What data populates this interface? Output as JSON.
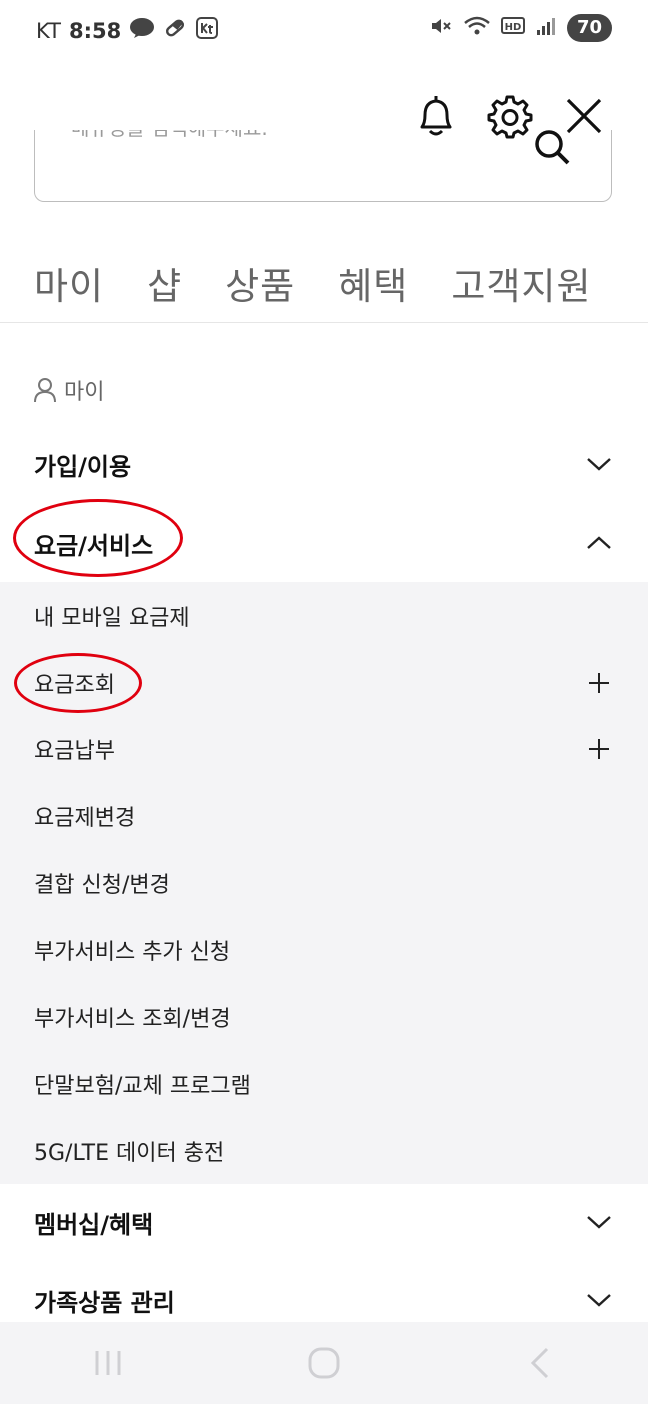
{
  "status": {
    "carrier": "KT",
    "time": "8:58",
    "battery": "70"
  },
  "search": {
    "placeholder_text": "메뉴명을 검색해주세요."
  },
  "tabs": [
    "마이",
    "샵",
    "상품",
    "혜택",
    "고객지원"
  ],
  "section": {
    "label": "마이"
  },
  "categories": {
    "join_use": "가입/이용",
    "fee_service": "요금/서비스",
    "membership": "멤버십/혜택",
    "family": "가족상품 관리"
  },
  "sub_items": [
    "내 모바일 요금제",
    "요금조회",
    "요금납부",
    "요금제변경",
    "결합 신청/변경",
    "부가서비스 추가 신청",
    "부가서비스 조회/변경",
    "단말보험/교체 프로그램",
    "5G/LTE 데이터 충전"
  ],
  "colors": {
    "annotation": "#e0000f",
    "panel": "#f4f4f6"
  }
}
